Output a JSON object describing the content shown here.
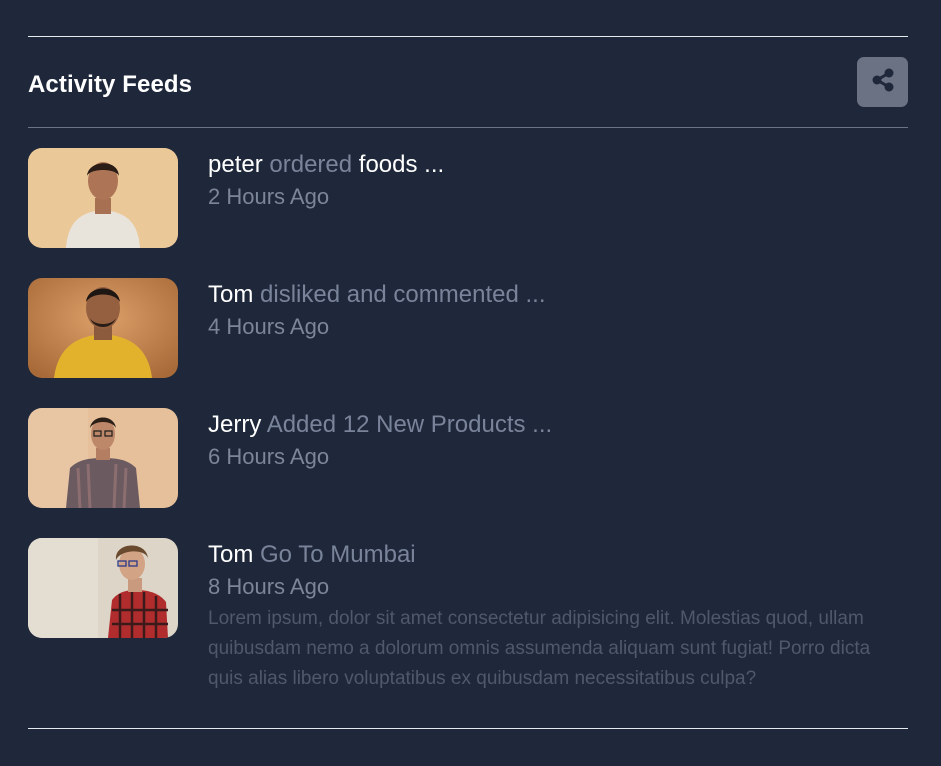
{
  "header": {
    "title": "Activity Feeds",
    "share_icon": "share-icon"
  },
  "feed": {
    "items": [
      {
        "name": "peter",
        "action": "ordered",
        "object": "foods ...",
        "time": "2 Hours Ago",
        "avatar": "person-photo"
      },
      {
        "name": "Tom",
        "action": "disliked and commented ...",
        "time": "4 Hours Ago",
        "avatar": "person-photo"
      },
      {
        "name": "Jerry",
        "action": "Added 12 New Products ...",
        "time": "6 Hours Ago",
        "avatar": "person-photo"
      },
      {
        "name": "Tom",
        "action": "Go To Mumbai",
        "time": "8 Hours Ago",
        "description": "Lorem ipsum, dolor sit amet consectetur adipisicing elit. Molestias quod, ullam quibusdam nemo a dolorum omnis assumenda aliquam sunt fugiat! Porro dicta quis alias libero voluptatibus ex quibusdam necessitatibus culpa?",
        "avatar": "person-photo"
      }
    ]
  },
  "colors": {
    "background": "#1f283a",
    "button": "#6b7284",
    "muted_text": "#79839a",
    "description_text": "#4f596c"
  }
}
